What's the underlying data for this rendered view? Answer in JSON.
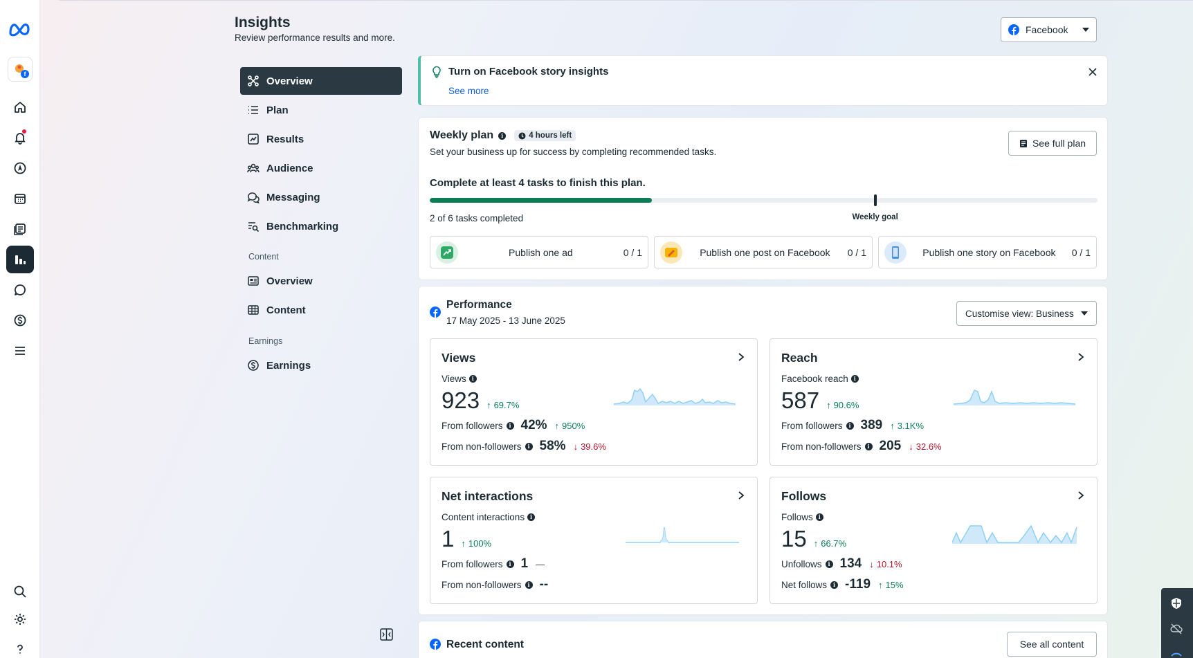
{
  "header": {
    "title": "Insights",
    "subtitle": "Review performance results and more.",
    "platform_select": "Facebook"
  },
  "nav": {
    "items": [
      {
        "label": "Overview",
        "icon": "overview-icon"
      },
      {
        "label": "Plan",
        "icon": "list-icon"
      },
      {
        "label": "Results",
        "icon": "line-chart-icon"
      },
      {
        "label": "Audience",
        "icon": "people-icon"
      },
      {
        "label": "Messaging",
        "icon": "chat-icon"
      },
      {
        "label": "Benchmarking",
        "icon": "benchmark-icon"
      }
    ],
    "content_section": "Content",
    "content_items": [
      {
        "label": "Overview",
        "icon": "content-overview-icon"
      },
      {
        "label": "Content",
        "icon": "table-icon"
      }
    ],
    "earnings_section": "Earnings",
    "earnings_items": [
      {
        "label": "Earnings",
        "icon": "dollar-icon"
      }
    ]
  },
  "banner": {
    "title": "Turn on Facebook story insights",
    "link": "See more"
  },
  "weekly_plan": {
    "title": "Weekly plan",
    "time_left": "4 hours left",
    "description": "Set your business up for success by completing recommended tasks.",
    "see_full_plan": "See full plan",
    "goal_text": "Complete at least 4 tasks to finish this plan.",
    "progress_fraction": 0.333,
    "goal_fraction": 0.667,
    "completed_text": "2 of 6 tasks completed",
    "goal_label": "Weekly goal",
    "tasks": [
      {
        "label": "Publish one ad",
        "count": "0 / 1"
      },
      {
        "label": "Publish one post on Facebook",
        "count": "0 / 1"
      },
      {
        "label": "Publish one story on Facebook",
        "count": "0 / 1"
      }
    ]
  },
  "performance": {
    "title": "Performance",
    "date_range": "17 May 2025 - 13 June 2025",
    "customise_label": "Customise view: Business",
    "views": {
      "title": "Views",
      "label": "Views",
      "value": "923",
      "delta": "69.7%",
      "row1_label": "From followers",
      "row1_value": "42%",
      "row1_delta": "950%",
      "row2_label": "From non-followers",
      "row2_value": "58%",
      "row2_delta": "39.6%"
    },
    "reach": {
      "title": "Reach",
      "label": "Facebook reach",
      "value": "587",
      "delta": "90.6%",
      "row1_label": "From followers",
      "row1_value": "389",
      "row1_delta": "3.1K%",
      "row2_label": "From non-followers",
      "row2_value": "205",
      "row2_delta": "32.6%"
    },
    "interactions": {
      "title": "Net interactions",
      "label": "Content interactions",
      "value": "1",
      "delta": "100%",
      "row1_label": "From followers",
      "row1_value": "1",
      "row1_delta": "—",
      "row2_label": "From non-followers",
      "row2_value": "--"
    },
    "follows": {
      "title": "Follows",
      "label": "Follows",
      "value": "15",
      "delta": "66.7%",
      "row1_label": "Unfollows",
      "row1_value": "134",
      "row1_delta": "10.1%",
      "row2_label": "Net follows",
      "row2_value": "-119",
      "row2_delta": "15%"
    }
  },
  "recent_content": {
    "title": "Recent content",
    "see_all": "See all content"
  },
  "colors": {
    "accent_green": "#0a7d55",
    "negative_red": "#b3152d",
    "link_blue": "#0a5bd8",
    "sparkline": "#8fd0f5",
    "nav_active": "#2b3a42"
  }
}
